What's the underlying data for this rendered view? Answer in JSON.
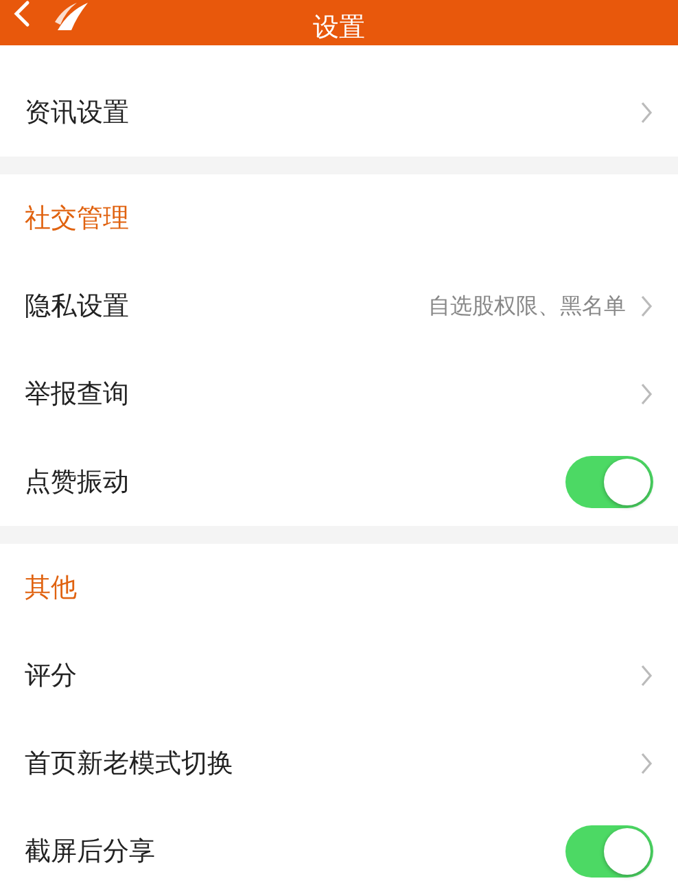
{
  "header": {
    "title": "设置"
  },
  "sections": [
    {
      "items": [
        {
          "kind": "link",
          "label": "资讯设置"
        }
      ]
    },
    {
      "title": "社交管理",
      "items": [
        {
          "kind": "link",
          "label": "隐私设置",
          "value": "自选股权限、黑名单"
        },
        {
          "kind": "link",
          "label": "举报查询"
        },
        {
          "kind": "toggle",
          "label": "点赞振动",
          "on": true
        }
      ]
    },
    {
      "title": "其他",
      "items": [
        {
          "kind": "link",
          "label": "评分"
        },
        {
          "kind": "link",
          "label": "首页新老模式切换"
        },
        {
          "kind": "toggle",
          "label": "截屏后分享",
          "on": true
        }
      ]
    }
  ]
}
